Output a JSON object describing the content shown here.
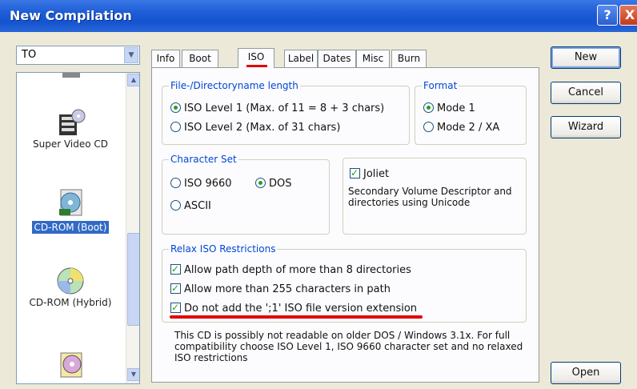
{
  "window": {
    "title": "New Compilation"
  },
  "title_buttons": {
    "help": "?",
    "close": "X"
  },
  "type_combo": {
    "value": "TO"
  },
  "type_list": {
    "items": [
      {
        "label": "",
        "icon": "disc-icon"
      },
      {
        "label": "Super Video CD",
        "icon": "super-video-cd-icon"
      },
      {
        "label": "CD-ROM (Boot)",
        "icon": "cd-rom-boot-icon",
        "selected": true
      },
      {
        "label": "CD-ROM (Hybrid)",
        "icon": "cd-rom-hybrid-icon"
      },
      {
        "label": "",
        "icon": "cd-rom-udf-icon"
      }
    ]
  },
  "tabs": [
    {
      "label": "Info"
    },
    {
      "label": "Boot"
    },
    {
      "label": "ISO",
      "active": true
    },
    {
      "label": "Label"
    },
    {
      "label": "Dates"
    },
    {
      "label": "Misc"
    },
    {
      "label": "Burn"
    }
  ],
  "iso": {
    "filename_group": {
      "title": "File-/Directoryname length",
      "options": [
        {
          "label": "ISO Level 1 (Max. of 11 = 8 + 3 chars)",
          "selected": true
        },
        {
          "label": "ISO Level 2 (Max. of 31 chars)",
          "selected": false
        }
      ]
    },
    "format_group": {
      "title": "Format",
      "options": [
        {
          "label": "Mode 1",
          "selected": true
        },
        {
          "label": "Mode 2 / XA",
          "selected": false
        }
      ]
    },
    "charset_group": {
      "title": "Character Set",
      "options": [
        {
          "label": "ISO 9660",
          "selected": false
        },
        {
          "label": "DOS",
          "selected": true
        },
        {
          "label": "ASCII",
          "selected": false
        }
      ]
    },
    "joliet": {
      "label": "Joliet",
      "checked": true,
      "description": "Secondary Volume Descriptor and directories using Unicode"
    },
    "relax_group": {
      "title": "Relax ISO Restrictions",
      "options": [
        {
          "label": "Allow path depth of more than 8 directories",
          "checked": true
        },
        {
          "label": "Allow more than 255 characters in path",
          "checked": true
        },
        {
          "label": "Do not add the ';1' ISO file version extension",
          "checked": true
        }
      ]
    },
    "info_text": "This CD is possibly not readable on older DOS / Windows 3.1x. For full compatibility choose ISO Level 1, ISO 9660 character set and no relaxed ISO restrictions"
  },
  "buttons": {
    "new": "New",
    "cancel": "Cancel",
    "wizard": "Wizard",
    "open": "Open"
  },
  "annotation_color": "#e00000"
}
